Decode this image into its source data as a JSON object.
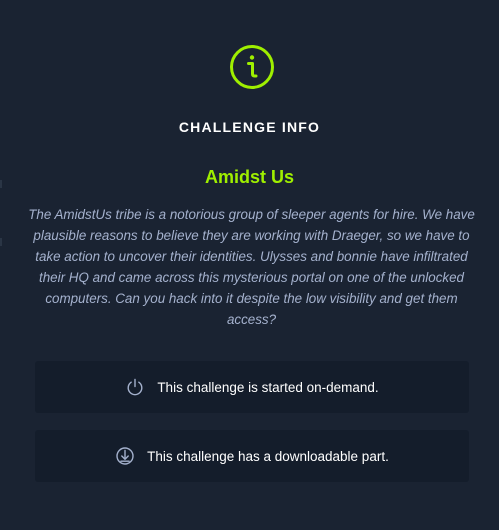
{
  "modal": {
    "icon": "info-circle-icon",
    "accent_color": "#9fef00",
    "heading": "CHALLENGE INFO",
    "challenge_name": "Amidst Us",
    "description": "The AmidstUs tribe is a notorious group of sleeper agents for hire. We have plausible reasons to believe they are working with Draeger, so we have to take action to uncover their identities. Ulysses and bonnie have infiltrated their HQ and came across this mysterious portal on one of the unlocked computers. Can you hack into it despite the low visibility and get them access?",
    "notes": [
      {
        "icon": "power-icon",
        "text": "This challenge is started on-demand."
      },
      {
        "icon": "download-icon",
        "text": "This challenge has a downloadable part."
      }
    ]
  }
}
